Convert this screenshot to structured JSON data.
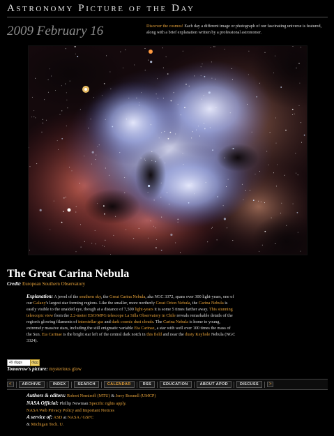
{
  "header": {
    "site_title": "Astronomy Picture of the Day",
    "date": "2009 February 16",
    "intro_link": "Discover the cosmos!",
    "intro_text": " Each day a different image or photograph of our fascinating universe is featured, along with a brief explanation written by a professional astronomer."
  },
  "image": {
    "alt": "Carina Nebula photograph"
  },
  "article": {
    "title": "The Great Carina Nebula",
    "credit_label": "Credit:",
    "credit_value": "European Southern Observatory",
    "explanation_label": "Explanation:",
    "explanation_parts": [
      {
        "t": " A jewel of the ",
        "l": false
      },
      {
        "t": "southern sky",
        "l": true
      },
      {
        "t": ", the ",
        "l": false
      },
      {
        "t": "Great Carina Nebula",
        "l": true
      },
      {
        "t": ", aka NGC 3372, spans over 300 light-years, one of our ",
        "l": false
      },
      {
        "t": "Galaxy",
        "l": true
      },
      {
        "t": "'s largest star forming regions. Like the smaller, more northerly ",
        "l": false
      },
      {
        "t": "Great Orion Nebula",
        "l": true
      },
      {
        "t": ", the ",
        "l": false
      },
      {
        "t": "Carina Nebula",
        "l": true
      },
      {
        "t": " is easily visible to the unaided eye, though at a distance of 7,500 ",
        "l": false
      },
      {
        "t": "light-years",
        "l": true
      },
      {
        "t": " it is some 5 times farther away. ",
        "l": false
      },
      {
        "t": "This stunning telescopic view",
        "l": true
      },
      {
        "t": " from the ",
        "l": false
      },
      {
        "t": "2.2-meter ESO/MPG telescope La Silla Observatory in Chile",
        "l": true
      },
      {
        "t": " reveals remarkable details of the region's glowing filaments of ",
        "l": false
      },
      {
        "t": "interstellar gas",
        "l": true
      },
      {
        "t": " and ",
        "l": false
      },
      {
        "t": "dark cosmic dust clouds",
        "l": true
      },
      {
        "t": ". The ",
        "l": false
      },
      {
        "t": "Carina Nebula",
        "l": true
      },
      {
        "t": " is home to young, extremely massive stars, including the still enigmatic variable ",
        "l": false
      },
      {
        "t": "Eta Carinae",
        "l": true
      },
      {
        "t": ", a star with well over 100 times the mass of the Sun. ",
        "l": false
      },
      {
        "t": "Eta Carinae",
        "l": true
      },
      {
        "t": " is the bright star left of the central dark notch in ",
        "l": false
      },
      {
        "t": "this field",
        "l": true
      },
      {
        "t": " and near the ",
        "l": false
      },
      {
        "t": "dusty Keyhole",
        "l": true
      },
      {
        "t": " Nebula (NGC 3324).",
        "l": false
      }
    ]
  },
  "share": {
    "count_label": "49 diggs",
    "button_label": "digg"
  },
  "tomorrow": {
    "label": "Tomorrow's picture:",
    "value": "mysterious glow"
  },
  "nav": {
    "prev": "<",
    "next": ">",
    "items": [
      "ARCHIVE",
      "INDEX",
      "SEARCH",
      "CALENDAR",
      "RSS",
      "EDUCATION",
      "ABOUT APOD",
      "DISCUSS"
    ],
    "active": "CALENDAR"
  },
  "footer": {
    "authors_label": "Authors & editors:",
    "authors_1": "Robert Nemiroff (MTU)",
    "authors_and": " & ",
    "authors_2": "Jerry Bonnell (UMCP)",
    "official_label": "NASA Official:",
    "official_name": " Phillip Newman ",
    "official_link": "Specific rights apply.",
    "privacy": "NASA Web Privacy Policy and Important Notices",
    "service_label": "A service of:",
    "service_1": "ASD",
    "service_at": " at ",
    "service_2": "NASA / GSFC",
    "service_amp": "& ",
    "service_3": "Michigan Tech. U."
  },
  "colors": {
    "link": "#e8a33a",
    "background": "#000000",
    "date": "#8c8c8c"
  }
}
